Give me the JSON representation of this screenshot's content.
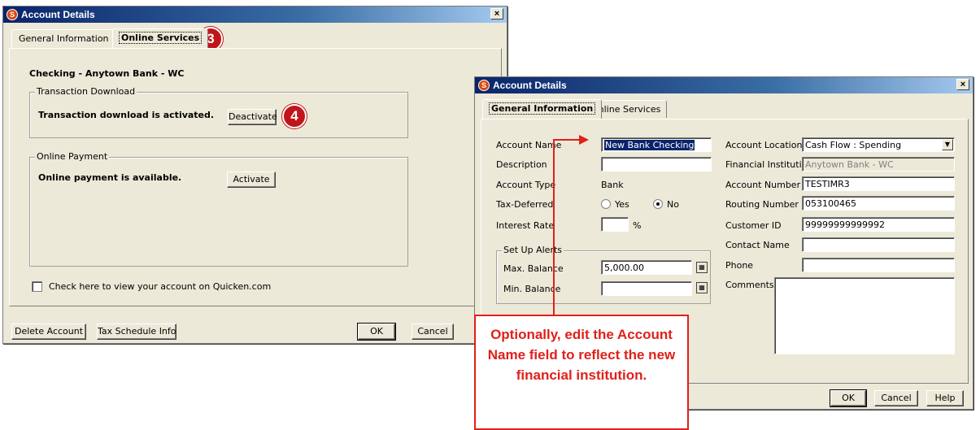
{
  "win1": {
    "title": "Account Details",
    "close_glyph": "×",
    "tabs": [
      "General Information",
      "Online Services"
    ],
    "account_heading": "Checking - Anytown Bank - WC",
    "transaction_download": {
      "legend": "Transaction Download",
      "status": "Transaction download is activated.",
      "button": "Deactivate"
    },
    "online_payment": {
      "legend": "Online Payment",
      "status": "Online payment is available.",
      "button": "Activate"
    },
    "quicken_checkbox_label": "Check here to view your account on Quicken.com",
    "footer": {
      "delete": "Delete Account",
      "tax": "Tax Schedule Info",
      "ok": "OK",
      "cancel": "Cancel"
    }
  },
  "win2": {
    "title": "Account Details",
    "close_glyph": "×",
    "tabs": [
      "General Information",
      "Online Services"
    ],
    "fields": {
      "account_name_label": "Account Name",
      "account_name_value": "New Bank Checking",
      "description_label": "Description",
      "description_value": "",
      "account_type_label": "Account Type",
      "account_type_value": "Bank",
      "tax_deferred_label": "Tax-Deferred",
      "tax_yes": "Yes",
      "tax_no": "No",
      "tax_selected": "No",
      "interest_rate_label": "Interest Rate",
      "interest_rate_value": "",
      "percent": "%"
    },
    "alerts": {
      "legend": "Set Up Alerts",
      "max_label": "Max. Balance",
      "max_value": "5,000.00",
      "min_label": "Min. Balance",
      "min_value": ""
    },
    "right": {
      "location_label": "Account Location",
      "location_value": "Cash Flow : Spending",
      "fi_label": "Financial Institution",
      "fi_value": "Anytown Bank - WC",
      "acct_num_label": "Account Number",
      "acct_num_value": "TESTIMR3",
      "routing_label": "Routing Number",
      "routing_value": "053100465",
      "customer_label": "Customer ID",
      "customer_value": "99999999999992",
      "contact_label": "Contact Name",
      "contact_value": "",
      "phone_label": "Phone",
      "phone_value": "",
      "comments_label": "Comments",
      "comments_value": ""
    },
    "footer": {
      "ok": "OK",
      "cancel": "Cancel",
      "help": "Help"
    }
  },
  "annotations": {
    "step3": "3",
    "step4": "4",
    "callout": "Optionally, edit the Account Name field to reflect the new financial institution.",
    "callout_color": "#e0201a"
  }
}
